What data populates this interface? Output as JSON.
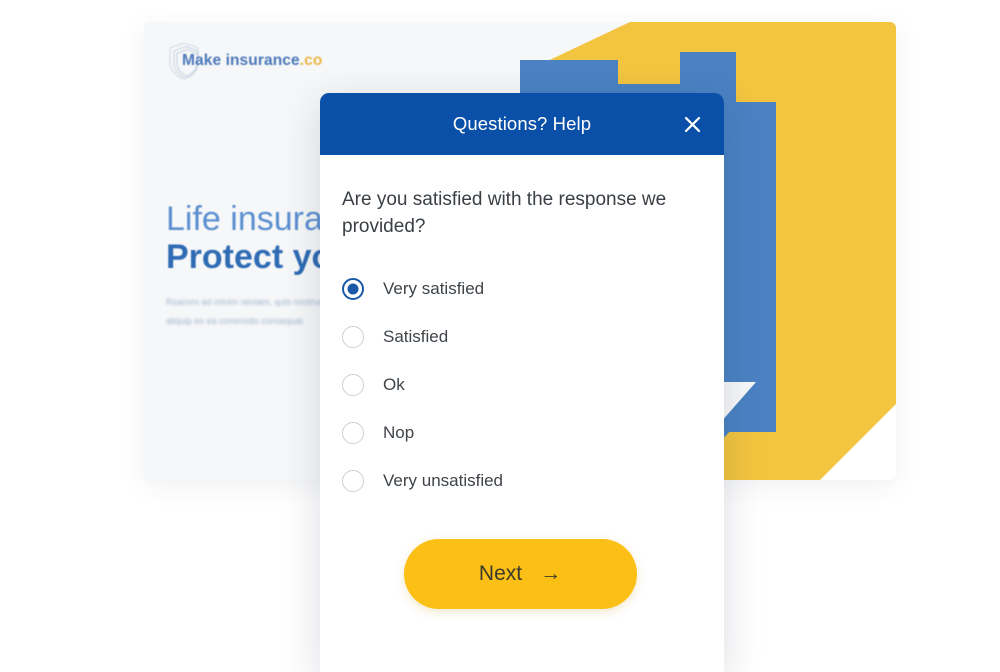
{
  "background_page": {
    "logo": {
      "icon": "shield-icon",
      "brand_text": "Make insurance",
      "suffix": ".co"
    },
    "hero": {
      "line1": "Life insurance",
      "line2": "Protect your family",
      "paragraph": "Rsanvm ad minim veniam, quis nostrud exercitation ullamco laboris nisi ut aliquip ex ea commodo consequat."
    },
    "illustration": {
      "name": "family-with-umbrella-illustration",
      "colors": {
        "yellow": "#f2c43f",
        "blue": "#4a82c3",
        "dark_blue": "#2f6cb4",
        "light_blue": "#cfe1f3",
        "navy": "#34546b"
      }
    }
  },
  "modal": {
    "header": {
      "title": "Questions? Help",
      "close_icon": "close-icon",
      "background_color": "#0b50a8"
    },
    "question": "Are you satisfied with the response we provided?",
    "options": [
      {
        "label": "Very satisfied",
        "selected": true
      },
      {
        "label": "Satisfied",
        "selected": false
      },
      {
        "label": "Ok",
        "selected": false
      },
      {
        "label": "Nop",
        "selected": false
      },
      {
        "label": "Very unsatisfied",
        "selected": false
      }
    ],
    "next_button": {
      "label": "Next",
      "arrow_icon": "arrow-right-icon",
      "arrow_glyph": "→",
      "background_color": "#fbbf15"
    },
    "accent_colors": {
      "radio_selected": "#1a58a8",
      "radio_unselected": "#c9cfd6"
    }
  }
}
